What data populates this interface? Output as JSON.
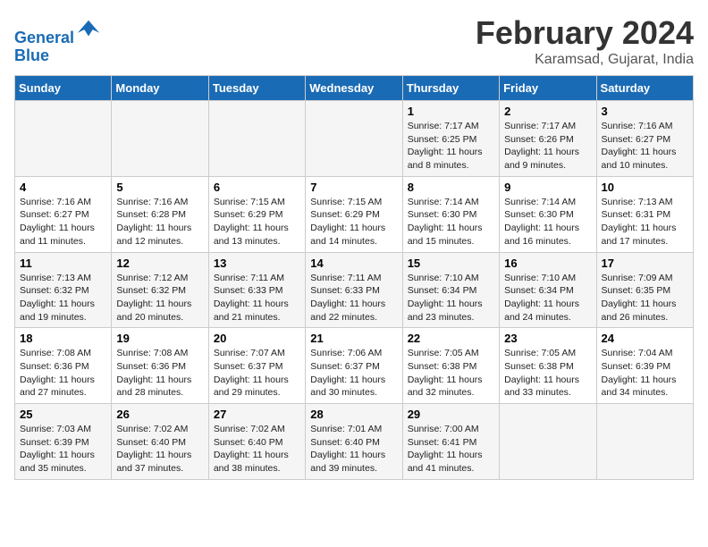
{
  "header": {
    "logo_line1": "General",
    "logo_line2": "Blue",
    "main_title": "February 2024",
    "subtitle": "Karamsad, Gujarat, India"
  },
  "days_of_week": [
    "Sunday",
    "Monday",
    "Tuesday",
    "Wednesday",
    "Thursday",
    "Friday",
    "Saturday"
  ],
  "weeks": [
    [
      {
        "num": "",
        "info": ""
      },
      {
        "num": "",
        "info": ""
      },
      {
        "num": "",
        "info": ""
      },
      {
        "num": "",
        "info": ""
      },
      {
        "num": "1",
        "info": "Sunrise: 7:17 AM\nSunset: 6:25 PM\nDaylight: 11 hours\nand 8 minutes."
      },
      {
        "num": "2",
        "info": "Sunrise: 7:17 AM\nSunset: 6:26 PM\nDaylight: 11 hours\nand 9 minutes."
      },
      {
        "num": "3",
        "info": "Sunrise: 7:16 AM\nSunset: 6:27 PM\nDaylight: 11 hours\nand 10 minutes."
      }
    ],
    [
      {
        "num": "4",
        "info": "Sunrise: 7:16 AM\nSunset: 6:27 PM\nDaylight: 11 hours\nand 11 minutes."
      },
      {
        "num": "5",
        "info": "Sunrise: 7:16 AM\nSunset: 6:28 PM\nDaylight: 11 hours\nand 12 minutes."
      },
      {
        "num": "6",
        "info": "Sunrise: 7:15 AM\nSunset: 6:29 PM\nDaylight: 11 hours\nand 13 minutes."
      },
      {
        "num": "7",
        "info": "Sunrise: 7:15 AM\nSunset: 6:29 PM\nDaylight: 11 hours\nand 14 minutes."
      },
      {
        "num": "8",
        "info": "Sunrise: 7:14 AM\nSunset: 6:30 PM\nDaylight: 11 hours\nand 15 minutes."
      },
      {
        "num": "9",
        "info": "Sunrise: 7:14 AM\nSunset: 6:30 PM\nDaylight: 11 hours\nand 16 minutes."
      },
      {
        "num": "10",
        "info": "Sunrise: 7:13 AM\nSunset: 6:31 PM\nDaylight: 11 hours\nand 17 minutes."
      }
    ],
    [
      {
        "num": "11",
        "info": "Sunrise: 7:13 AM\nSunset: 6:32 PM\nDaylight: 11 hours\nand 19 minutes."
      },
      {
        "num": "12",
        "info": "Sunrise: 7:12 AM\nSunset: 6:32 PM\nDaylight: 11 hours\nand 20 minutes."
      },
      {
        "num": "13",
        "info": "Sunrise: 7:11 AM\nSunset: 6:33 PM\nDaylight: 11 hours\nand 21 minutes."
      },
      {
        "num": "14",
        "info": "Sunrise: 7:11 AM\nSunset: 6:33 PM\nDaylight: 11 hours\nand 22 minutes."
      },
      {
        "num": "15",
        "info": "Sunrise: 7:10 AM\nSunset: 6:34 PM\nDaylight: 11 hours\nand 23 minutes."
      },
      {
        "num": "16",
        "info": "Sunrise: 7:10 AM\nSunset: 6:34 PM\nDaylight: 11 hours\nand 24 minutes."
      },
      {
        "num": "17",
        "info": "Sunrise: 7:09 AM\nSunset: 6:35 PM\nDaylight: 11 hours\nand 26 minutes."
      }
    ],
    [
      {
        "num": "18",
        "info": "Sunrise: 7:08 AM\nSunset: 6:36 PM\nDaylight: 11 hours\nand 27 minutes."
      },
      {
        "num": "19",
        "info": "Sunrise: 7:08 AM\nSunset: 6:36 PM\nDaylight: 11 hours\nand 28 minutes."
      },
      {
        "num": "20",
        "info": "Sunrise: 7:07 AM\nSunset: 6:37 PM\nDaylight: 11 hours\nand 29 minutes."
      },
      {
        "num": "21",
        "info": "Sunrise: 7:06 AM\nSunset: 6:37 PM\nDaylight: 11 hours\nand 30 minutes."
      },
      {
        "num": "22",
        "info": "Sunrise: 7:05 AM\nSunset: 6:38 PM\nDaylight: 11 hours\nand 32 minutes."
      },
      {
        "num": "23",
        "info": "Sunrise: 7:05 AM\nSunset: 6:38 PM\nDaylight: 11 hours\nand 33 minutes."
      },
      {
        "num": "24",
        "info": "Sunrise: 7:04 AM\nSunset: 6:39 PM\nDaylight: 11 hours\nand 34 minutes."
      }
    ],
    [
      {
        "num": "25",
        "info": "Sunrise: 7:03 AM\nSunset: 6:39 PM\nDaylight: 11 hours\nand 35 minutes."
      },
      {
        "num": "26",
        "info": "Sunrise: 7:02 AM\nSunset: 6:40 PM\nDaylight: 11 hours\nand 37 minutes."
      },
      {
        "num": "27",
        "info": "Sunrise: 7:02 AM\nSunset: 6:40 PM\nDaylight: 11 hours\nand 38 minutes."
      },
      {
        "num": "28",
        "info": "Sunrise: 7:01 AM\nSunset: 6:40 PM\nDaylight: 11 hours\nand 39 minutes."
      },
      {
        "num": "29",
        "info": "Sunrise: 7:00 AM\nSunset: 6:41 PM\nDaylight: 11 hours\nand 41 minutes."
      },
      {
        "num": "",
        "info": ""
      },
      {
        "num": "",
        "info": ""
      }
    ]
  ]
}
